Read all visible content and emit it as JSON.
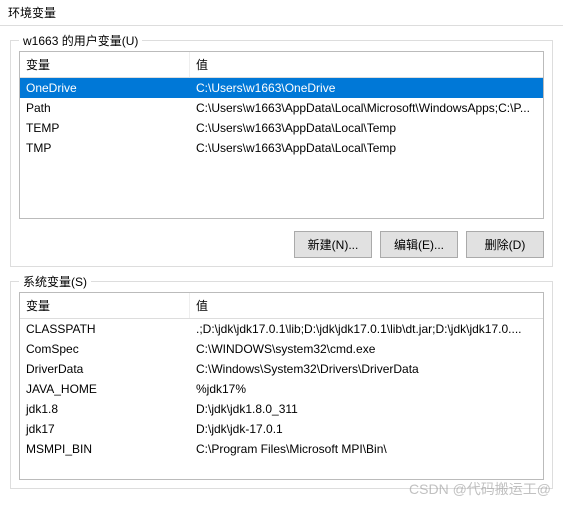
{
  "window": {
    "title": "环境变量"
  },
  "user_section": {
    "label": "w1663 的用户变量(U)",
    "header_var": "变量",
    "header_val": "值",
    "rows": [
      {
        "var": "OneDrive",
        "val": "C:\\Users\\w1663\\OneDrive",
        "selected": true
      },
      {
        "var": "Path",
        "val": "C:\\Users\\w1663\\AppData\\Local\\Microsoft\\WindowsApps;C:\\P...",
        "selected": false
      },
      {
        "var": "TEMP",
        "val": "C:\\Users\\w1663\\AppData\\Local\\Temp",
        "selected": false
      },
      {
        "var": "TMP",
        "val": "C:\\Users\\w1663\\AppData\\Local\\Temp",
        "selected": false
      }
    ]
  },
  "buttons": {
    "new": "新建(N)...",
    "edit": "编辑(E)...",
    "delete": "删除(D)"
  },
  "sys_section": {
    "label": "系统变量(S)",
    "header_var": "变量",
    "header_val": "值",
    "rows": [
      {
        "var": "CLASSPATH",
        "val": ".;D:\\jdk\\jdk17.0.1\\lib;D:\\jdk\\jdk17.0.1\\lib\\dt.jar;D:\\jdk\\jdk17.0...."
      },
      {
        "var": "ComSpec",
        "val": "C:\\WINDOWS\\system32\\cmd.exe"
      },
      {
        "var": "DriverData",
        "val": "C:\\Windows\\System32\\Drivers\\DriverData"
      },
      {
        "var": "JAVA_HOME",
        "val": "%jdk17%"
      },
      {
        "var": "jdk1.8",
        "val": "D:\\jdk\\jdk1.8.0_311"
      },
      {
        "var": "jdk17",
        "val": "D:\\jdk\\jdk-17.0.1"
      },
      {
        "var": "MSMPI_BIN",
        "val": "C:\\Program Files\\Microsoft MPI\\Bin\\"
      }
    ]
  },
  "watermark": "CSDN @代码搬运工@"
}
